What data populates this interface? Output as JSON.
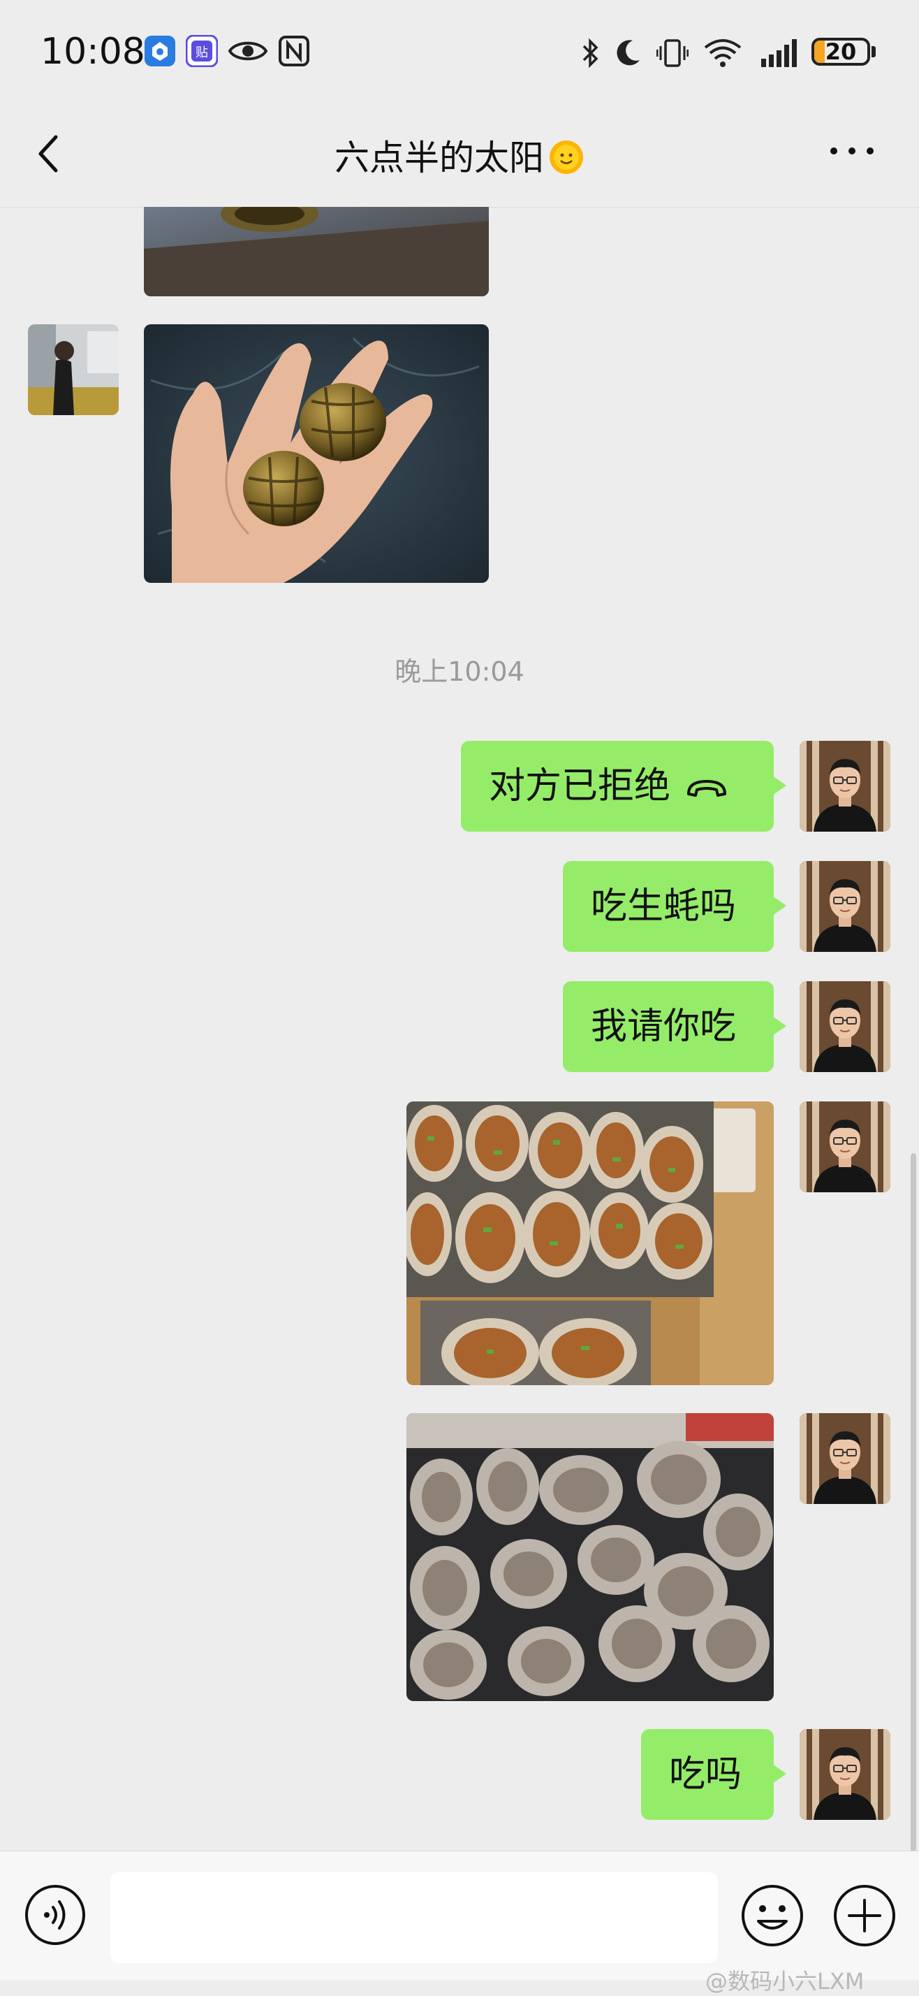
{
  "status_bar": {
    "time": "10:08",
    "battery_level": "20",
    "battery_fraction": 0.2,
    "accent_battery": "#f5a623"
  },
  "header": {
    "back_icon": "chevron-left-icon",
    "title": "六点半的太阳",
    "title_emoji": "sun-emoji-icon",
    "more_icon": "more-horizontal-icon"
  },
  "messages": {
    "timestamp": "晚上10:04",
    "call_rejected": "对方已拒绝",
    "msg_oyster_raw": "吃生蚝吗",
    "msg_treat": "我请你吃",
    "msg_eat": "吃吗"
  },
  "input_bar": {
    "placeholder": "",
    "voice_icon": "voice-input-icon",
    "emoji_icon": "emoji-icon",
    "plus_icon": "plus-icon"
  },
  "watermark": "@数码小六LXM",
  "colors": {
    "bubble_green": "#95ec69",
    "background": "#ededed"
  }
}
